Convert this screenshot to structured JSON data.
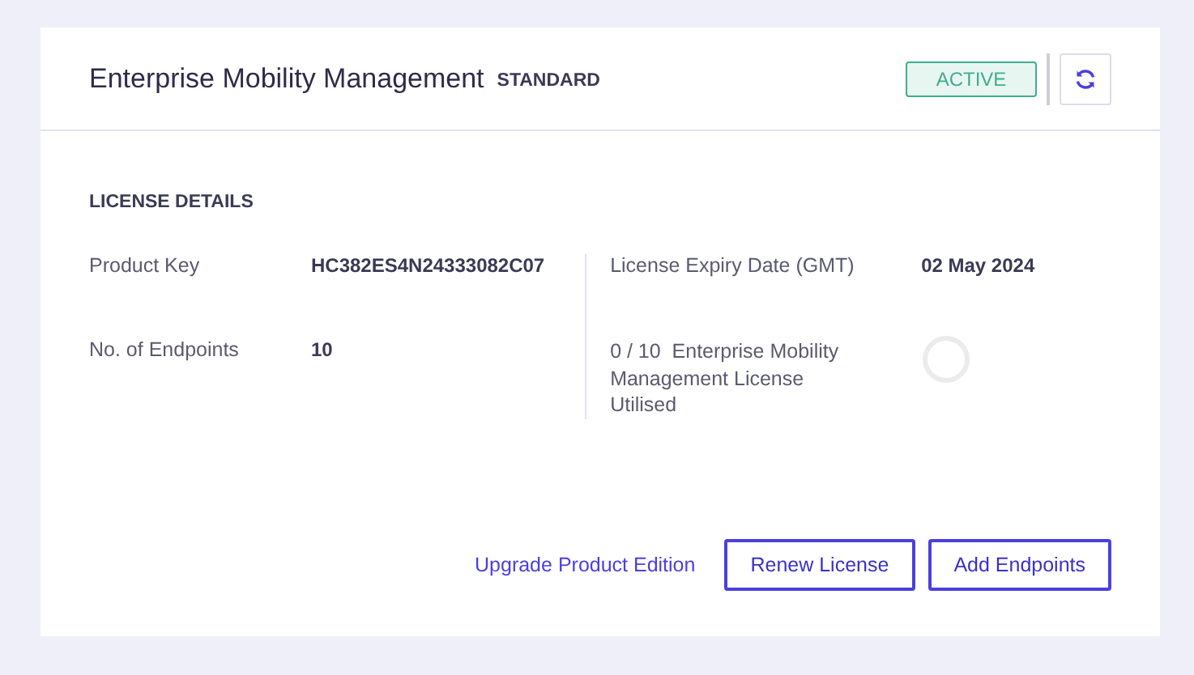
{
  "header": {
    "title": "Enterprise Mobility Management",
    "edition": "STANDARD",
    "status": "ACTIVE"
  },
  "section_title": "LICENSE DETAILS",
  "left": [
    {
      "label": "Product Key",
      "value": "HC382ES4N24333082C07"
    },
    {
      "label": "No. of Endpoints",
      "value": "10"
    }
  ],
  "right": {
    "expiry_label": "License Expiry Date (GMT)",
    "expiry_value": "02 May 2024",
    "usage": {
      "count": "0 / 10",
      "label": "Enterprise Mobility Management License Utilised"
    }
  },
  "actions": {
    "link": "Upgrade Product Edition",
    "buttons": [
      "Renew License",
      "Add Endpoints"
    ]
  }
}
